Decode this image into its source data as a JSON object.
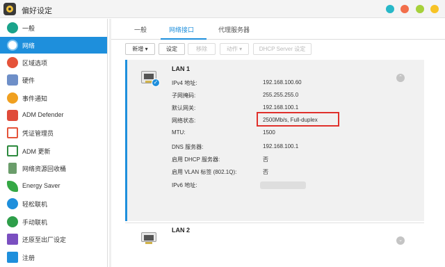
{
  "window": {
    "title": "偏好设定"
  },
  "sidebar": {
    "items": [
      {
        "label": "一般",
        "icon": "general-icon",
        "color": "#1aa38b"
      },
      {
        "label": "网络",
        "icon": "network-globe-icon",
        "color": "#ffffff",
        "active": true
      },
      {
        "label": "区域选项",
        "icon": "region-icon",
        "color": "#e5533a"
      },
      {
        "label": "硬件",
        "icon": "hardware-icon",
        "color": "#6e8fc8"
      },
      {
        "label": "事件通知",
        "icon": "notification-icon",
        "color": "#f0a020"
      },
      {
        "label": "ADM Defender",
        "icon": "defender-icon",
        "color": "#e04b3a"
      },
      {
        "label": "凭证管理员",
        "icon": "certificate-icon",
        "color": "#e5533a"
      },
      {
        "label": "ADM 更新",
        "icon": "update-icon",
        "color": "#2d8a3e"
      },
      {
        "label": "网络资源回收桶",
        "icon": "recycle-bin-icon",
        "color": "#6b9d6b"
      },
      {
        "label": "Energy Saver",
        "icon": "energy-saver-icon",
        "color": "#35a845"
      },
      {
        "label": "轻松联机",
        "icon": "easy-connect-icon",
        "color": "#1e8fdc"
      },
      {
        "label": "手动联机",
        "icon": "manual-connect-icon",
        "color": "#2e9e4a"
      },
      {
        "label": "还原至出厂设定",
        "icon": "factory-reset-icon",
        "color": "#7a4fc0"
      },
      {
        "label": "注册",
        "icon": "register-icon",
        "color": "#1e8fdc"
      }
    ]
  },
  "tabs": [
    {
      "label": "一般"
    },
    {
      "label": "网络接口",
      "active": true
    },
    {
      "label": "代理服务器"
    }
  ],
  "toolbar": {
    "add": "新增 ▾",
    "settings": "设定",
    "remove": "移除",
    "action": "动作 ▾",
    "dhcp": "DHCP Server 设定"
  },
  "lan1": {
    "title": "LAN 1",
    "rows": [
      {
        "label": "IPv4 地址:",
        "value": "192.168.100.60"
      },
      {
        "label": "子网掩码:",
        "value": "255.255.255.0"
      },
      {
        "label": "默认网关:",
        "value": "192.168.100.1"
      },
      {
        "label": "网络状态:",
        "value": "2500Mb/s, Full-duplex"
      },
      {
        "label": "MTU:",
        "value": "1500"
      },
      {
        "label": "DNS 服务器:",
        "value": "192.168.100.1"
      },
      {
        "label": "启用 DHCP 服务器:",
        "value": "否"
      },
      {
        "label": "启用 VLAN 标签 (802.1Q):",
        "value": "否"
      },
      {
        "label": "IPv6 地址:",
        "value": ""
      }
    ]
  },
  "lan2": {
    "title": "LAN 2"
  },
  "colors": {
    "accent": "#1e8fdc",
    "highlight_border": "#e0302b"
  }
}
